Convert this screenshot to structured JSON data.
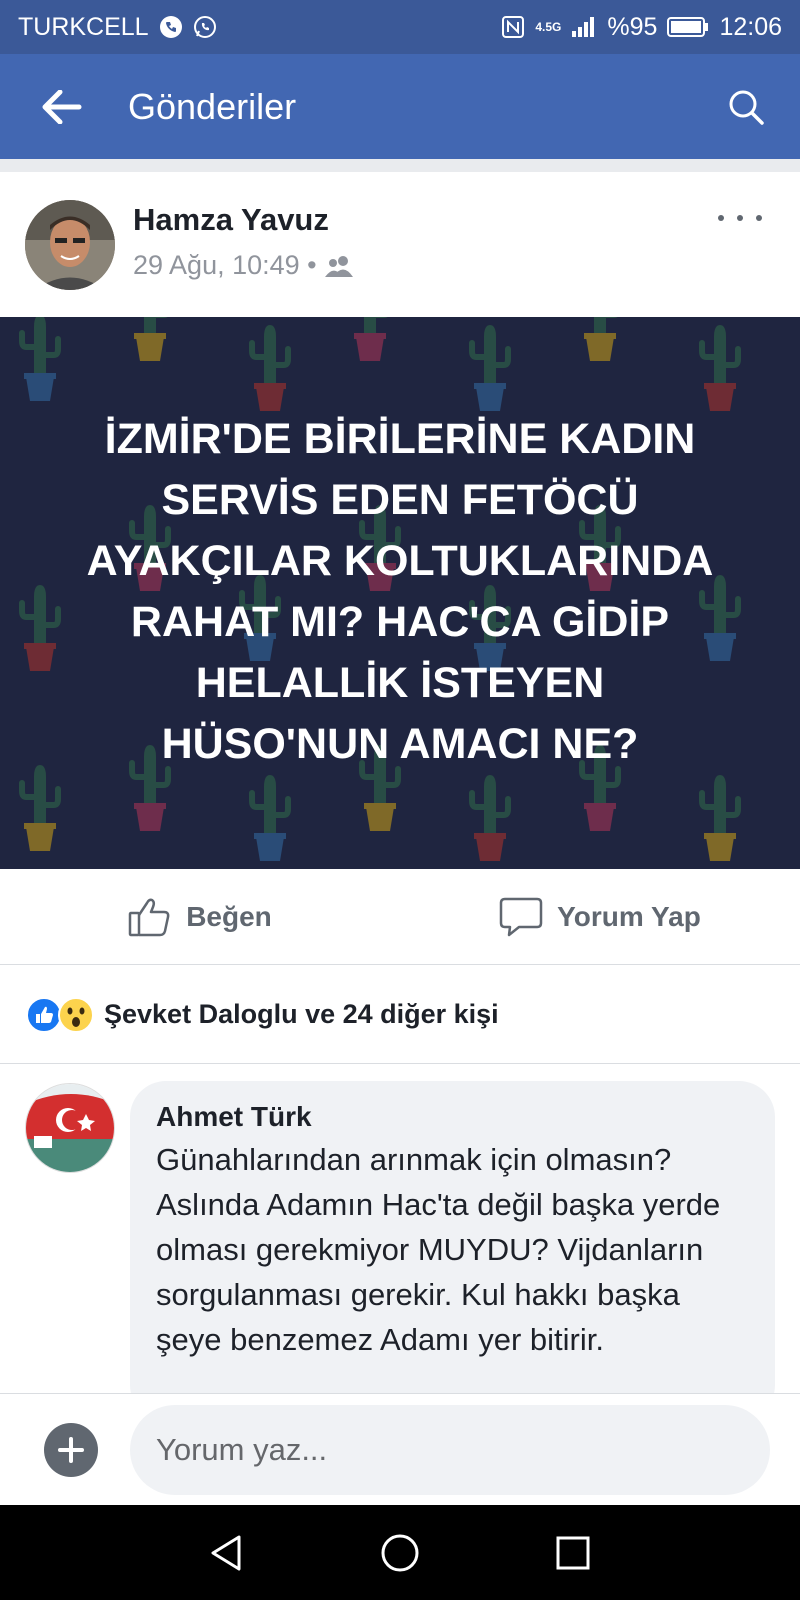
{
  "status_bar": {
    "carrier": "TURKCELL",
    "network": "4.5G",
    "battery": "%95",
    "time": "12:06"
  },
  "app_bar": {
    "title": "Gönderiler"
  },
  "post": {
    "author": "Hamza Yavuz",
    "timestamp": "29 Ağu, 10:49 •",
    "audience_icon": "friends-icon",
    "image_text": "İZMİR'DE BİRİLERİNE KADIN\nSERVİS EDEN FETÖCÜ\nAYAKÇILAR KOLTUKLARINDA\nRAHAT MI?  HAC'CA GİDİP\nHELALLİK İSTEYEN\nHÜSO'NUN AMACI NE?"
  },
  "actions": {
    "like_label": "Beğen",
    "comment_label": "Yorum Yap"
  },
  "reactions": {
    "summary": "Şevket Daloglu ve 24 diğer kişi",
    "icons": [
      "like-reaction-icon",
      "wow-reaction-icon"
    ]
  },
  "comment": {
    "author": "Ahmet Türk",
    "text": "Günahlarından arınmak için olmasın? Aslında Adamın Hac'ta değil başka yerde olması gerekmiyor MUYDU? Vijdanların sorgulanması gerekir. Kul hakkı başka şeye benzemez Adamı yer bitirir."
  },
  "compose": {
    "placeholder": "Yorum yaz..."
  },
  "colors": {
    "header": "#4267b2",
    "status": "#3b5998",
    "text_secondary": "#606770",
    "like_blue": "#1877f2",
    "image_bg": "#1f2540"
  }
}
